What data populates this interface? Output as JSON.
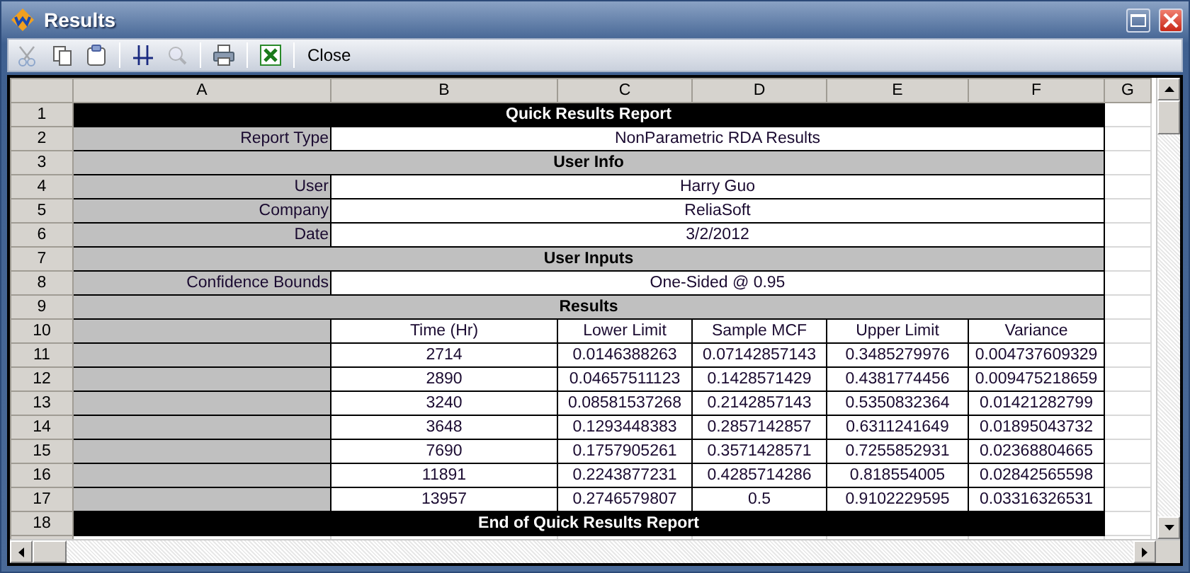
{
  "window": {
    "title": "Results"
  },
  "toolbar": [
    {
      "kind": "cut",
      "disabled": true
    },
    {
      "kind": "copy",
      "disabled": false
    },
    {
      "kind": "paste",
      "disabled": false
    },
    {
      "kind": "separator"
    },
    {
      "kind": "gridlines",
      "disabled": false
    },
    {
      "kind": "zoom",
      "disabled": true
    },
    {
      "kind": "separator"
    },
    {
      "kind": "print",
      "disabled": false
    },
    {
      "kind": "separator"
    },
    {
      "kind": "excel",
      "disabled": false
    },
    {
      "kind": "separator"
    },
    {
      "kind": "text",
      "label": "Close"
    }
  ],
  "columns": [
    "A",
    "B",
    "C",
    "D",
    "E",
    "F",
    "G"
  ],
  "rows": [
    {
      "number": "1",
      "kind": "banner",
      "text": "Quick Results Report"
    },
    {
      "number": "2",
      "kind": "field",
      "label": "Report Type",
      "value": "NonParametric RDA Results"
    },
    {
      "number": "3",
      "kind": "section",
      "text": "User Info"
    },
    {
      "number": "4",
      "kind": "field",
      "label": "User",
      "value": "Harry Guo"
    },
    {
      "number": "5",
      "kind": "field",
      "label": "Company",
      "value": "ReliaSoft"
    },
    {
      "number": "6",
      "kind": "field",
      "label": "Date",
      "value": "3/2/2012"
    },
    {
      "number": "7",
      "kind": "section",
      "text": "User Inputs"
    },
    {
      "number": "8",
      "kind": "field",
      "label": "Confidence Bounds",
      "value": "One-Sided @ 0.95"
    },
    {
      "number": "9",
      "kind": "section",
      "text": "Results"
    },
    {
      "number": "10",
      "kind": "data",
      "cells": [
        "Time (Hr)",
        "Lower Limit",
        "Sample MCF",
        "Upper Limit",
        "Variance"
      ]
    },
    {
      "number": "11",
      "kind": "data",
      "cells": [
        "2714",
        "0.0146388263",
        "0.07142857143",
        "0.3485279976",
        "0.004737609329"
      ]
    },
    {
      "number": "12",
      "kind": "data",
      "cells": [
        "2890",
        "0.04657511123",
        "0.1428571429",
        "0.4381774456",
        "0.009475218659"
      ]
    },
    {
      "number": "13",
      "kind": "data",
      "cells": [
        "3240",
        "0.08581537268",
        "0.2142857143",
        "0.5350832364",
        "0.01421282799"
      ]
    },
    {
      "number": "14",
      "kind": "data",
      "cells": [
        "3648",
        "0.1293448383",
        "0.2857142857",
        "0.6311241649",
        "0.01895043732"
      ]
    },
    {
      "number": "15",
      "kind": "data",
      "cells": [
        "7690",
        "0.1757905261",
        "0.3571428571",
        "0.7255852931",
        "0.02368804665"
      ]
    },
    {
      "number": "16",
      "kind": "data",
      "cells": [
        "11891",
        "0.2243877231",
        "0.4285714286",
        "0.818554005",
        "0.02842565598"
      ]
    },
    {
      "number": "17",
      "kind": "data",
      "cells": [
        "13957",
        "0.2746579807",
        "0.5",
        "0.9102229595",
        "0.03316326531"
      ]
    },
    {
      "number": "18",
      "kind": "banner",
      "text": "End of Quick Results Report"
    }
  ]
}
